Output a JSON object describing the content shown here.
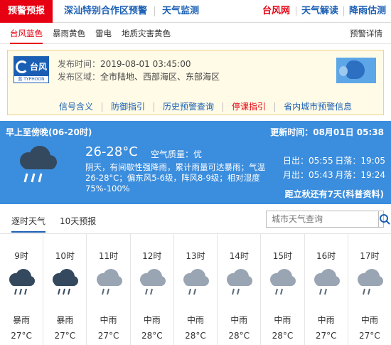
{
  "nav": {
    "warning_tab": "预警预报",
    "links": [
      "深汕特别合作区预警",
      "天气监测"
    ],
    "typhoon_link": "台风网",
    "right_links": [
      "天气解读",
      "降雨估测"
    ]
  },
  "alert_tabs": {
    "items": [
      "台风蓝色",
      "暴雨黄色",
      "雷电",
      "地质灾害黄色"
    ],
    "active_index": 0,
    "details_link": "预警详情"
  },
  "alert": {
    "icon": {
      "char1": "台",
      "char2": "风",
      "level": "蓝",
      "english": "TYPHOON"
    },
    "time_label": "发布时间：",
    "time_value": "2019-08-01 03:45:00",
    "area_label": "发布区域：",
    "area_value": "全市陆地、西部海区、东部海区",
    "links": [
      "信号含义",
      "防御指引",
      "历史预警查询",
      "停课指引",
      "省内城市预警信息"
    ],
    "red_link_index": 3
  },
  "weather": {
    "period": "早上至傍晚(06-20时)",
    "updated": "更新时间：08月01日 05:38",
    "temp": "26-28°C",
    "aq_label": "空气质量：",
    "aq_value": "优",
    "description": "阴天，有间歇性强降雨，累计雨量可达暴雨；气温26-28°C；偏东风5-6级，阵风8-9级；相对湿度75%-100%",
    "sunrise_label": "日出：",
    "sunrise": "05:55",
    "sunset_label": "日落：",
    "sunset": "19:05",
    "moonrise_label": "月出：",
    "moonrise": "05:43",
    "moonset_label": "月落：",
    "moonset": "19:24",
    "countdown": "距立秋还有7天(科普资料)"
  },
  "forecast": {
    "tabs": [
      "逐时天气",
      "10天预报"
    ],
    "active_index": 0,
    "search_placeholder": "城市天气查询",
    "hours": [
      {
        "time": "9时",
        "cond": "暴雨",
        "temp": "27°C",
        "icon": "rainstorm-icon"
      },
      {
        "time": "10时",
        "cond": "暴雨",
        "temp": "27°C",
        "icon": "rainstorm-icon"
      },
      {
        "time": "11时",
        "cond": "中雨",
        "temp": "27°C",
        "icon": "moderate-rain-icon"
      },
      {
        "time": "12时",
        "cond": "中雨",
        "temp": "28°C",
        "icon": "moderate-rain-icon"
      },
      {
        "time": "13时",
        "cond": "中雨",
        "temp": "28°C",
        "icon": "moderate-rain-icon"
      },
      {
        "time": "14时",
        "cond": "中雨",
        "temp": "28°C",
        "icon": "moderate-rain-icon"
      },
      {
        "time": "15时",
        "cond": "中雨",
        "temp": "28°C",
        "icon": "moderate-rain-icon"
      },
      {
        "time": "16时",
        "cond": "中雨",
        "temp": "27°C",
        "icon": "moderate-rain-icon"
      },
      {
        "time": "17时",
        "cond": "中雨",
        "temp": "27°C",
        "icon": "moderate-rain-icon"
      }
    ]
  },
  "colors": {
    "warning_red": "#e60012",
    "link_blue": "#1a5fb4",
    "weather_bg": "#3b8ddd",
    "dark_cloud": "#34495e",
    "light_cloud": "#9aa5b3"
  }
}
